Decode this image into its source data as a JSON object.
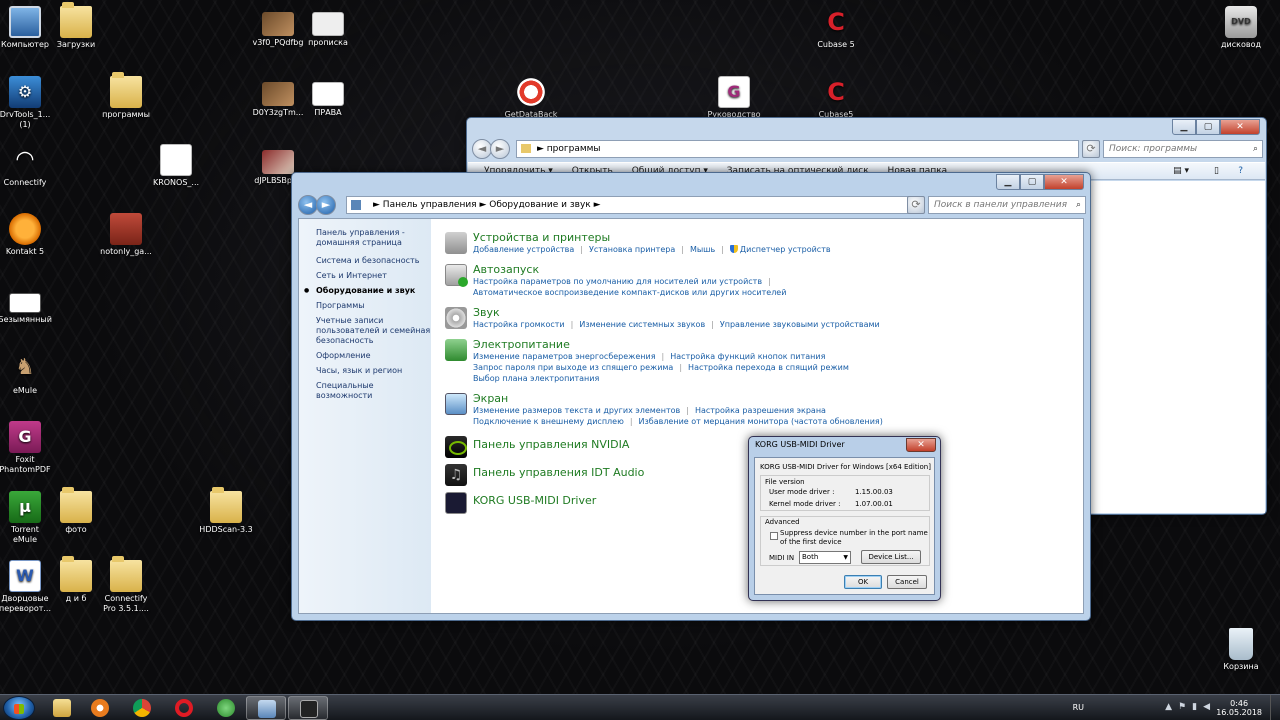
{
  "desktop": {
    "icons": {
      "computer": "Компьютер",
      "downloads": "Загрузки",
      "drvtools": "DrvTools_1...\n(1)",
      "programs": "программы",
      "connectify": "Connectify",
      "kronos": "KRONOS_...",
      "kontakt": "Kontakt 5",
      "notonly": "notonly_ga...",
      "bezymyanny": "Безымянный",
      "emule": "eMule",
      "foxit": "Foxit\nPhantomPDF",
      "torrent": "Torrent\neMule",
      "foto": "фото",
      "hddscan": "HDDScan-3.3",
      "dvorts": "Дворцовые\nпереворот...",
      "di6": "д и б",
      "connectify_pro": "Connectify\nPro 3.5.1....",
      "v3f0": "v3f0_PQdfbg",
      "propiska": "прописка",
      "d0y3": "D0Y3zgTm...",
      "prava": "ПРАВА",
      "djplbs": "dJPLBSBpl...",
      "getdataback": "GetDataBack",
      "rukovodstvo": "Руководство",
      "cubase5a": "Cubase 5",
      "cubase5b": "Cubase5",
      "diskovod": "дисковод",
      "korzina": "Корзина"
    }
  },
  "explorer": {
    "address": "программы",
    "search_placeholder": "Поиск: программы",
    "toolbar": [
      "Упорядочить ▾",
      "Открыть",
      "Общий доступ ▾",
      "Записать на оптический диск",
      "Новая папка"
    ]
  },
  "cpanel": {
    "breadcrumb": [
      "Панель управления",
      "Оборудование и звук"
    ],
    "search_placeholder": "Поиск в панели управления",
    "sidebar": [
      "Панель управления - домашняя страница",
      "Система и безопасность",
      "Сеть и Интернет",
      "Оборудование и звук",
      "Программы",
      "Учетные записи пользователей и семейная безопасность",
      "Оформление",
      "Часы, язык и регион",
      "Специальные возможности"
    ],
    "categories": [
      {
        "title": "Устройства и принтеры",
        "links": [
          [
            "Добавление устройства",
            "Установка принтера",
            "Мышь",
            "Диспетчер устройств"
          ]
        ]
      },
      {
        "title": "Автозапуск",
        "links": [
          [
            "Настройка параметров по умолчанию для носителей или устройств"
          ],
          [
            "Автоматическое воспроизведение компакт-дисков или других носителей"
          ]
        ]
      },
      {
        "title": "Звук",
        "links": [
          [
            "Настройка громкости",
            "Изменение системных звуков",
            "Управление звуковыми устройствами"
          ]
        ]
      },
      {
        "title": "Электропитание",
        "links": [
          [
            "Изменение параметров энергосбережения",
            "Настройка функций кнопок питания"
          ],
          [
            "Запрос пароля при выходе из спящего режима",
            "Настройка перехода в спящий режим"
          ],
          [
            "Выбор плана электропитания"
          ]
        ]
      },
      {
        "title": "Экран",
        "links": [
          [
            "Изменение размеров текста и других элементов",
            "Настройка разрешения экрана"
          ],
          [
            "Подключение к внешнему дисплею",
            "Избавление от мерцания монитора (частота обновления)"
          ]
        ]
      }
    ],
    "extra": [
      "Панель управления NVIDIA",
      "Панель управления IDT Audio",
      "KORG USB-MIDI Driver"
    ]
  },
  "korg": {
    "title": "KORG USB-MIDI Driver",
    "heading": "KORG USB-MIDI Driver for Windows [x64 Edition]",
    "file_version": "File version",
    "user_mode_label": "User mode driver :",
    "user_mode_value": "1.15.00.03",
    "kernel_mode_label": "Kernel mode driver :",
    "kernel_mode_value": "1.07.00.01",
    "advanced": "Advanced",
    "suppress": "Suppress device number in the port name\nof the first device",
    "midi_in_label": "MIDI IN",
    "midi_in_value": "Both",
    "device_list": "Device List...",
    "ok": "OK",
    "cancel": "Cancel"
  },
  "taskbar": {
    "lang": "RU",
    "time": "0:46",
    "date": "16.05.2018"
  }
}
